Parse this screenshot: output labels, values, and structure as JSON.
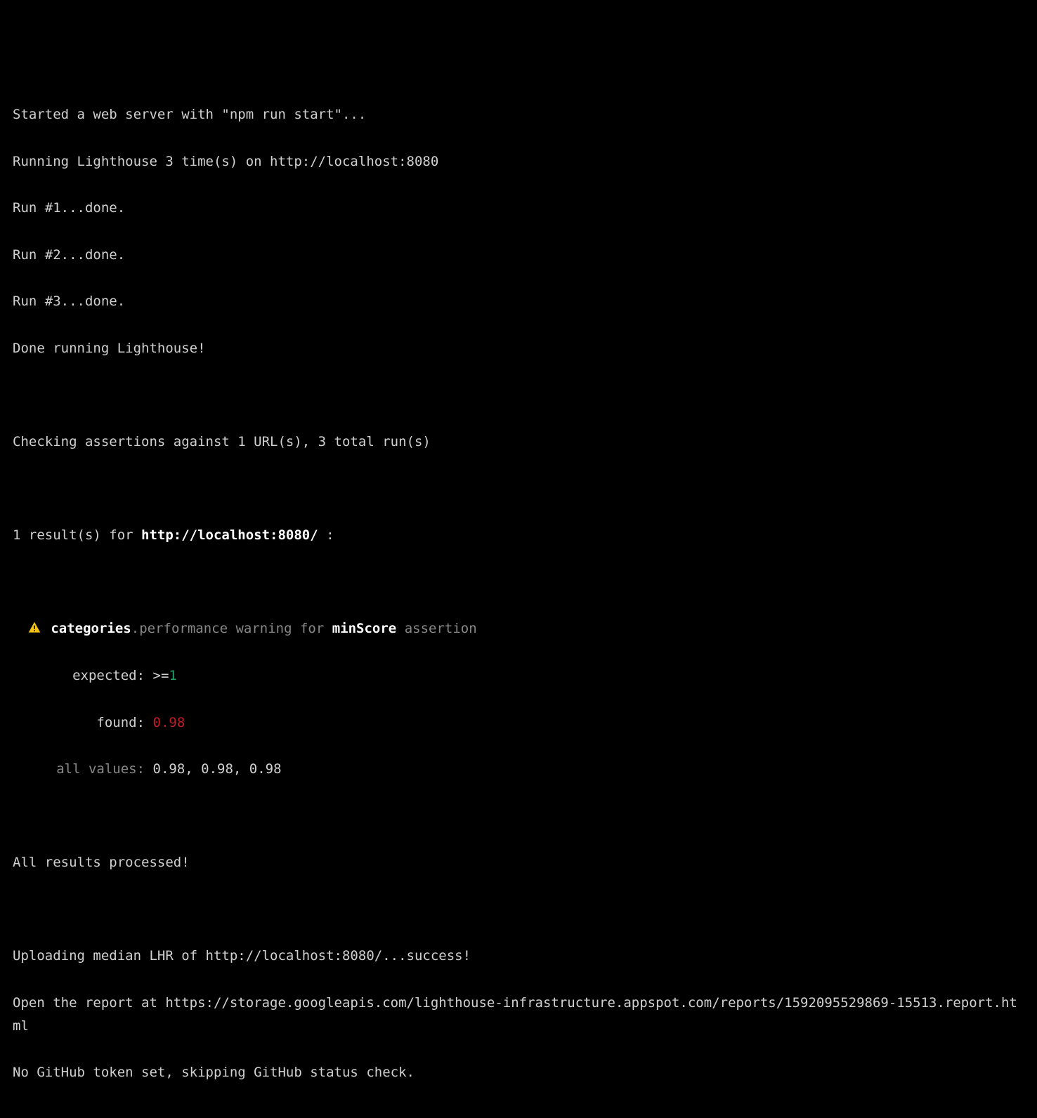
{
  "log": {
    "started": "Started a web server with \"npm run start\"...",
    "running": "Running Lighthouse 3 time(s) on http://localhost:8080",
    "run1": "Run #1...done.",
    "run2": "Run #2...done.",
    "run3": "Run #3...done.",
    "doneRunning": "Done running Lighthouse!",
    "checking": "Checking assertions against 1 URL(s), 3 total run(s)",
    "resultsPrefix": "1 result(s) for ",
    "resultsUrl": "http://localhost:8080/",
    "resultsSuffix": " :",
    "warn": {
      "categoriesLabel": "categories",
      "dot": ".",
      "middle": "performance warning for ",
      "minScoreLabel": "minScore",
      "suffix": " assertion",
      "expectedLabel": "expected: ",
      "expectedPrefix": ">=",
      "expectedValue": "1",
      "foundLabel": "found: ",
      "foundValue": "0.98",
      "allValuesLabel": "all values: ",
      "allValues": "0.98, 0.98, 0.98"
    },
    "allProcessed": "All results processed!",
    "uploading": "Uploading median LHR of http://localhost:8080/...success!",
    "openReport": "Open the report at https://storage.googleapis.com/lighthouse-infrastructure.appspot.com/reports/1592095529869-15513.report.html",
    "noToken": "No GitHub token set, skipping GitHub status check."
  }
}
